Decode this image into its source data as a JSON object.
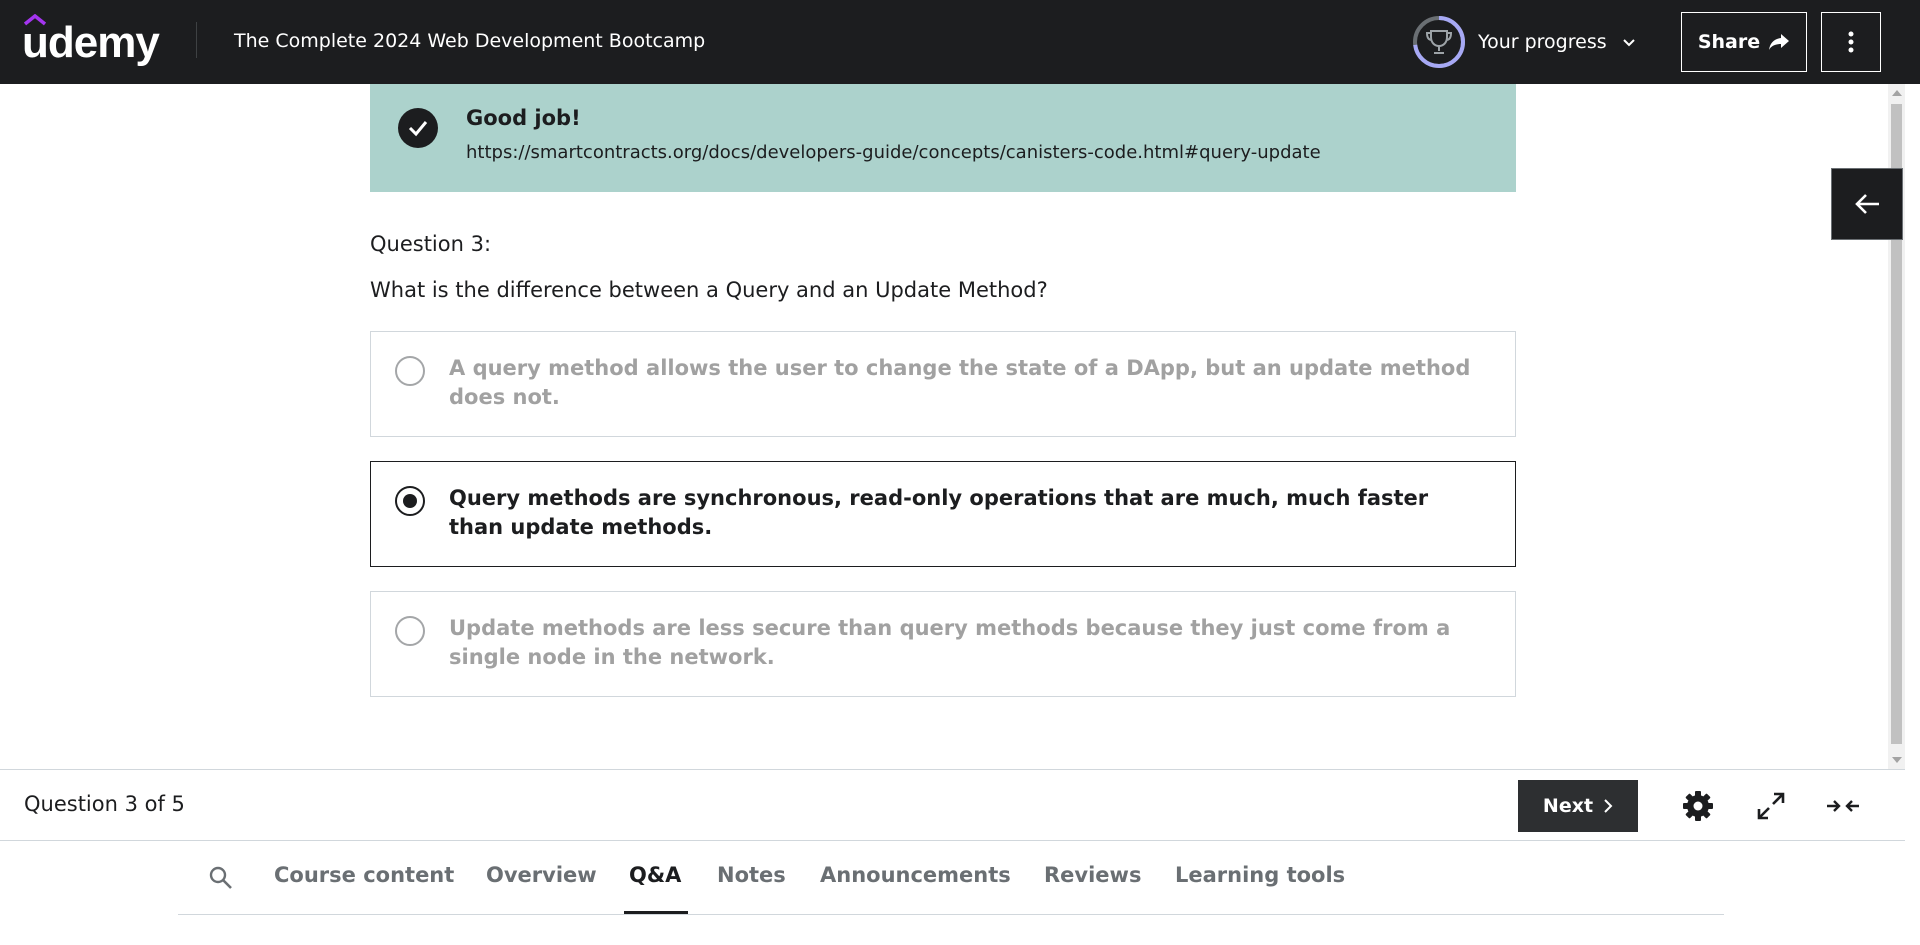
{
  "header": {
    "logo_text": "udemy",
    "course_title": "The Complete 2024 Web Development Bootcamp",
    "progress_label": "Your progress",
    "share_label": "Share"
  },
  "feedback": {
    "title": "Good job!",
    "link": "https://smartcontracts.org/docs/developers-guide/concepts/canisters-code.html#query-update"
  },
  "question": {
    "number_label": "Question 3:",
    "text": "What is the difference between a Query and an Update Method?",
    "options": [
      {
        "text": "A query method allows the user to change the state of a DApp, but an update method does not.",
        "selected": false
      },
      {
        "text": "Query methods are synchronous, read-only operations that are much, much faster than update methods.",
        "selected": true
      },
      {
        "text": "Update methods are less secure than query methods because they just come from a single node in the network.",
        "selected": false
      }
    ]
  },
  "footer": {
    "counter": "Question 3 of 5",
    "next_label": "Next"
  },
  "tabs": [
    {
      "label": "Course content",
      "active": false
    },
    {
      "label": "Overview",
      "active": false
    },
    {
      "label": "Q&A",
      "active": true
    },
    {
      "label": "Notes",
      "active": false
    },
    {
      "label": "Announcements",
      "active": false
    },
    {
      "label": "Reviews",
      "active": false
    },
    {
      "label": "Learning tools",
      "active": false
    }
  ],
  "colors": {
    "header_bg": "#1c1d1f",
    "feedback_bg": "#acd2cc",
    "brand_purple": "#a435f0",
    "progress_ring": "#a7a9f5"
  },
  "icons": [
    "trophy-icon",
    "chevron-down-icon",
    "share-arrow-icon",
    "more-vertical-icon",
    "arrow-left-icon",
    "checkmark-icon",
    "chevron-right-icon",
    "gear-icon",
    "expand-icon",
    "collapse-icon",
    "search-icon"
  ]
}
